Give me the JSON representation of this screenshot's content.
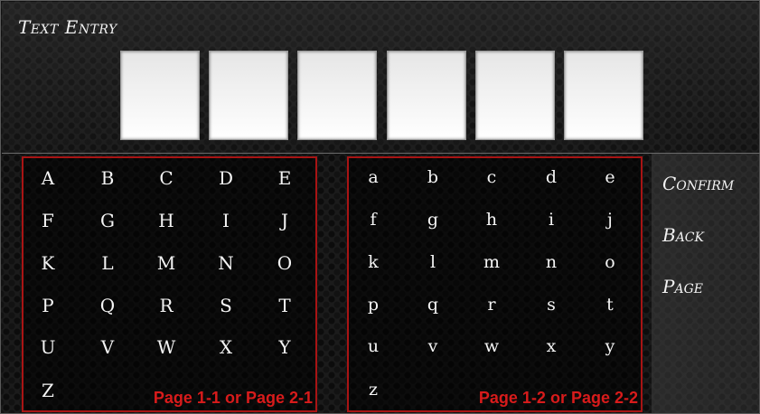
{
  "title": "Text Entry",
  "slots": [
    "",
    "",
    "",
    "",
    "",
    ""
  ],
  "uppercase": {
    "keys": [
      "A",
      "B",
      "C",
      "D",
      "E",
      "F",
      "G",
      "H",
      "I",
      "J",
      "K",
      "L",
      "M",
      "N",
      "O",
      "P",
      "Q",
      "R",
      "S",
      "T",
      "U",
      "V",
      "W",
      "X",
      "Y",
      "Z"
    ],
    "page_label": "Page 1-1 or Page 2-1"
  },
  "lowercase": {
    "keys": [
      "a",
      "b",
      "c",
      "d",
      "e",
      "f",
      "g",
      "h",
      "i",
      "j",
      "k",
      "l",
      "m",
      "n",
      "o",
      "p",
      "q",
      "r",
      "s",
      "t",
      "u",
      "v",
      "w",
      "x",
      "y",
      "z"
    ],
    "page_label": "Page 1-2 or Page 2-2"
  },
  "commands": {
    "confirm": "Confirm",
    "back": "Back",
    "page": "Page"
  },
  "colors": {
    "accent_red": "#a81414",
    "label_red": "#d81b1b"
  }
}
